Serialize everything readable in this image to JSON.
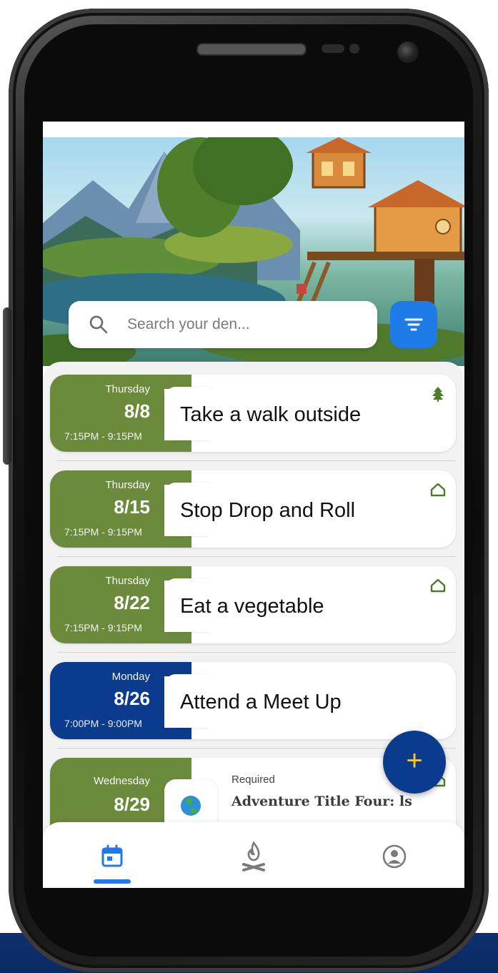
{
  "search": {
    "placeholder": "Search your den..."
  },
  "cards": [
    {
      "day": "Thursday",
      "date": "8/8",
      "time": "7:15PM - 9:15PM",
      "overlay": "Take a walk outside",
      "status_icon": "pine-tree-icon",
      "color": "#6b8a3c"
    },
    {
      "day": "Thursday",
      "date": "8/15",
      "time": "7:15PM - 9:15PM",
      "overlay": "Stop Drop and Roll",
      "status_icon": "house-outline-icon",
      "color": "#6b8a3c"
    },
    {
      "day": "Thursday",
      "date": "8/22",
      "time": "7:15PM - 9:15PM",
      "overlay": "Eat a vegetable",
      "status_icon": "house-outline-icon",
      "color": "#6b8a3c"
    },
    {
      "day": "Monday",
      "date": "8/26",
      "time": "7:00PM - 9:00PM",
      "overlay": "Attend a Meet Up",
      "status_icon": "",
      "color": "#0b3b8c"
    },
    {
      "day": "Wednesday",
      "date": "8/29",
      "time": "",
      "label": "Required",
      "title": "Adventure Title Four: ls",
      "status_icon": "house-outline-icon",
      "color": "#6b8a3c"
    }
  ],
  "fab": {
    "label": "+"
  },
  "nav": {
    "items": [
      "calendar-icon",
      "campfire-icon",
      "profile-icon"
    ],
    "active": "calendar-icon"
  },
  "colors": {
    "accent": "#1e7be8",
    "navy": "#0b3b8c",
    "green": "#6b8a3c",
    "fab_plus": "#f4c431"
  }
}
